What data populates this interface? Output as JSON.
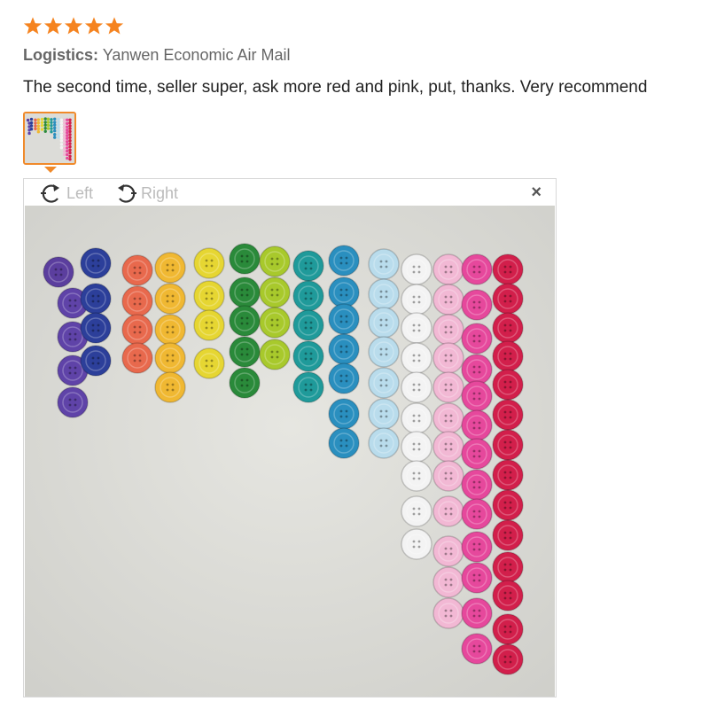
{
  "rating": {
    "stars": 5,
    "max": 5,
    "star_color": "#f5831f"
  },
  "logistics": {
    "label": "Logistics:",
    "value": "Yanwen Economic Air Mail"
  },
  "review": {
    "text": "The second time, seller super, ask more red and pink, put, thanks. Very recommend"
  },
  "thumbnail": {
    "selected": true,
    "border_color": "#f08a2b"
  },
  "viewer": {
    "rotate_left_label": "Left",
    "rotate_right_label": "Right",
    "close_symbol": "×",
    "icons": {
      "rotate_left": "rotate-left-icon",
      "rotate_right": "rotate-right-icon",
      "close": "close-icon"
    }
  }
}
